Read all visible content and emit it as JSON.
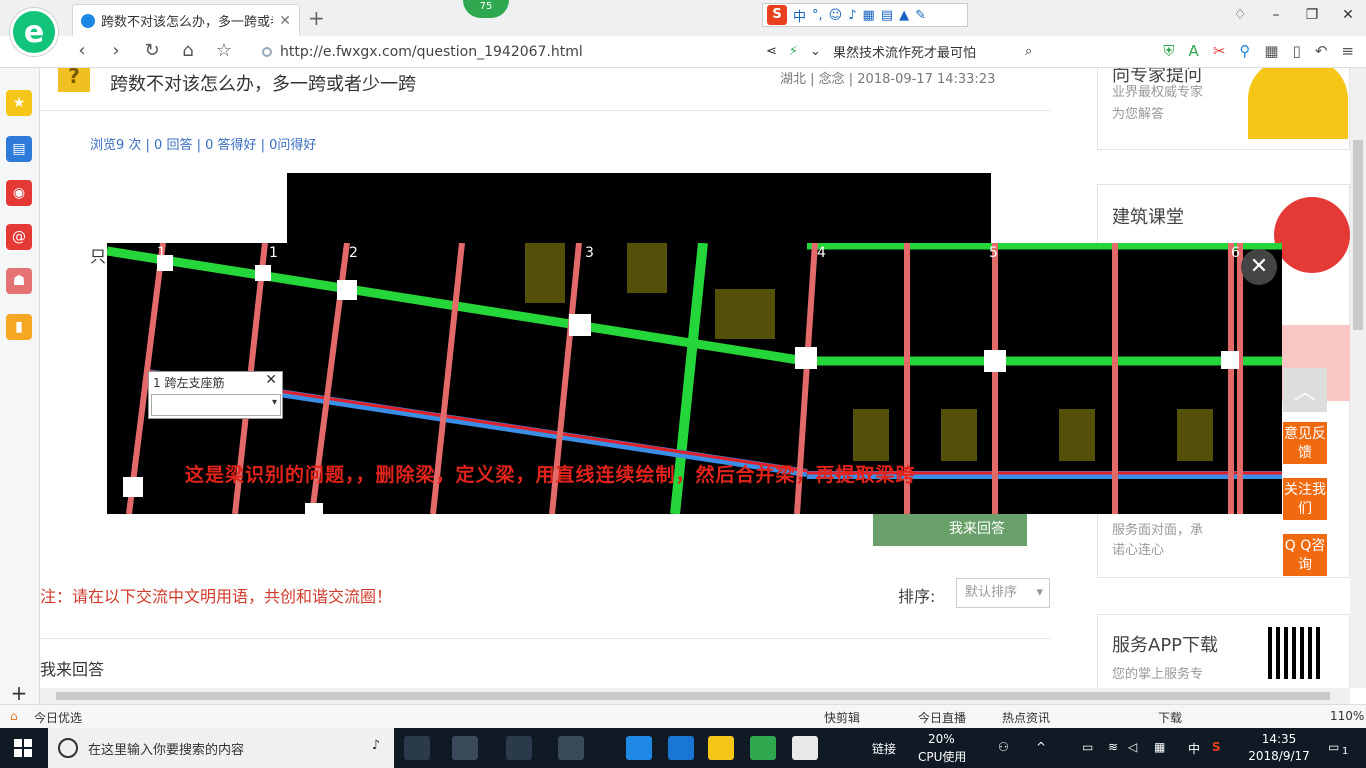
{
  "browser": {
    "tab_title": "跨数不对该怎么办，多一跨或者少一跨",
    "badge": "75",
    "url": "http://e.fwxgx.com/question_1942067.html",
    "search_text": "果然技术流作死才最可怕",
    "ime_label": "中",
    "new_tab_symbol": "+"
  },
  "question": {
    "title": "跨数不对该怎么办，多一跨或者少一跨",
    "meta": "湖北 | 念念 | 2018-09-17 14:33:23",
    "stats": "浏览9 次 | 0 回答 | 0 答得好 | 0问得好",
    "body_prefix": "只"
  },
  "viewer": {
    "caption": "这是梁识别的问题，，删除梁，定义梁，用直线连续绘制，然后合并梁，再提取梁跨",
    "popup_title": "1 跨左支座筋",
    "axis_labels": [
      "1",
      "1",
      "2",
      "3",
      "4",
      "5",
      "6"
    ]
  },
  "page": {
    "answer_button": "我来回答",
    "notice": "注：请在以下交流中文明用语，共创和谐交流圈！",
    "sort_label": "排序:",
    "sort_value": "默认排序",
    "my_answer": "我来回答"
  },
  "right": {
    "expert_title": "向专家提问",
    "expert_desc_1": "业界最权威专家",
    "expert_desc_2": "为您解答",
    "class_title": "建筑课堂",
    "service_desc_1": "服务面对面，承",
    "service_desc_2": "诺心连心",
    "app_title": "服务APP下载",
    "app_desc": "您的掌上服务专"
  },
  "float": {
    "feedback": "意见反馈",
    "follow": "关注我们",
    "qq": "Q Q咨询"
  },
  "statusbar": {
    "left": "今日优选",
    "items": [
      "快剪辑",
      "今日直播",
      "热点资讯",
      "下载"
    ],
    "zoom": "110%"
  },
  "taskbar": {
    "search_placeholder": "在这里输入你要搜索的内容",
    "link": "链接",
    "cpu_percent": "20%",
    "cpu_label": "CPU使用",
    "ime": "中",
    "time": "14:35",
    "date": "2018/9/17",
    "notif": "1"
  },
  "colors": {
    "green_beam": "#25d63a",
    "pink_beam": "#e46a6a",
    "caption_red": "#e1241b",
    "orange": "#f26a10"
  }
}
